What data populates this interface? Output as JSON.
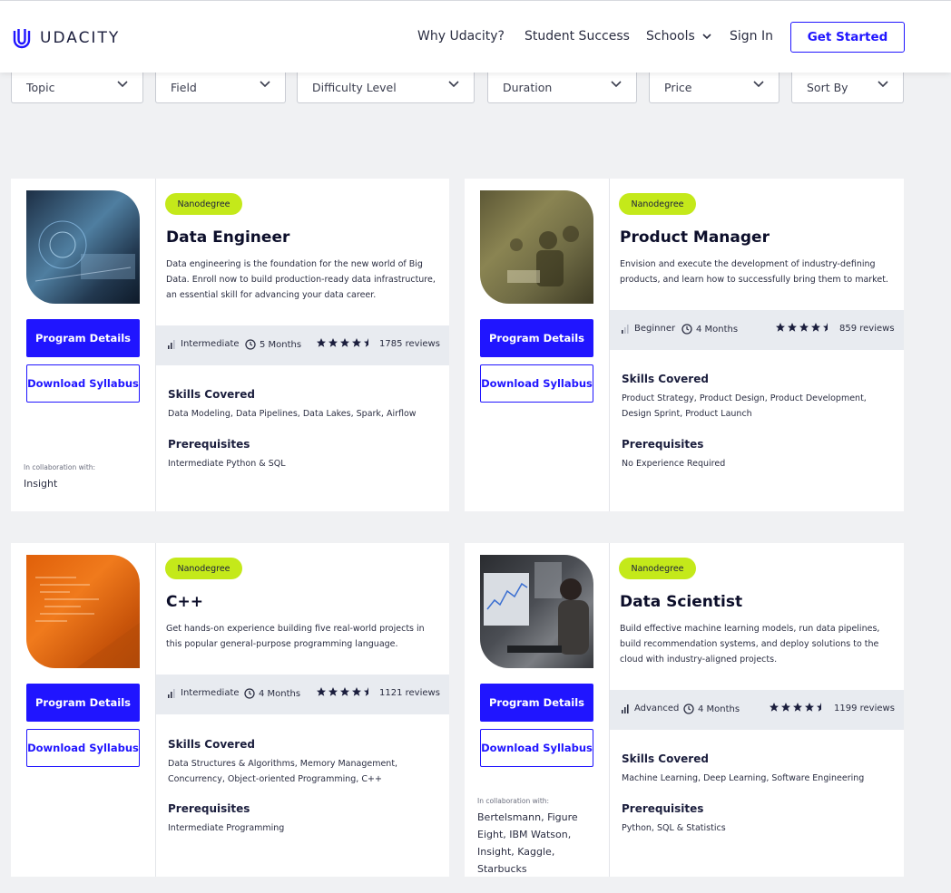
{
  "header": {
    "brand": "UDACITY",
    "nav": [
      "Why Udacity?",
      "Student Success",
      "Schools",
      "Sign In"
    ],
    "cta": "Get Started"
  },
  "filters": [
    "Topic",
    "Field",
    "Difficulty Level",
    "Duration",
    "Price",
    "Sort By"
  ],
  "colors": {
    "accent": "#2015ff",
    "badge": "#c4e91a",
    "meta_bg": "#e8ebf0"
  },
  "cards": [
    {
      "badge": "Nanodegree",
      "title": "Data Engineer",
      "description": "Data engineering is the foundation for the new world of Big Data. Enroll now to build production-ready data infrastructure, an essential skill for advancing your data career.",
      "level": "Intermediate",
      "duration": "5 Months",
      "rating_stars": 4.5,
      "reviews": "1785 reviews",
      "skills_heading": "Skills Covered",
      "skills": "Data Modeling, Data Pipelines, Data Lakes, Spark, Airflow",
      "prereq_heading": "Prerequisites",
      "prereq": "Intermediate Python & SQL",
      "program_details": "Program Details",
      "download_syllabus": "Download Syllabus",
      "collab_label": "In collaboration with:",
      "collab": "Insight"
    },
    {
      "badge": "Nanodegree",
      "title": "Product Manager",
      "description": "Envision and execute the development of industry-defining products, and learn how to successfully bring them to market.",
      "level": "Beginner",
      "duration": "4 Months",
      "rating_stars": 4.5,
      "reviews": "859 reviews",
      "skills_heading": "Skills Covered",
      "skills": "Product Strategy, Product Design, Product Development, Design Sprint, Product Launch",
      "prereq_heading": "Prerequisites",
      "prereq": "No Experience Required",
      "program_details": "Program Details",
      "download_syllabus": "Download Syllabus"
    },
    {
      "badge": "Nanodegree",
      "title": "C++",
      "description": "Get hands-on experience building five real-world projects in this popular general-purpose programming language.",
      "level": "Intermediate",
      "duration": "4 Months",
      "rating_stars": 4.5,
      "reviews": "1121 reviews",
      "skills_heading": "Skills Covered",
      "skills": "Data Structures & Algorithms, Memory Management, Concurrency, Object-oriented Programming, C++",
      "prereq_heading": "Prerequisites",
      "prereq": "Intermediate Programming",
      "program_details": "Program Details",
      "download_syllabus": "Download Syllabus"
    },
    {
      "badge": "Nanodegree",
      "title": "Data Scientist",
      "description": "Build effective machine learning models, run data pipelines, build recommendation systems, and deploy solutions to the cloud with industry-aligned projects.",
      "level": "Advanced",
      "duration": "4 Months",
      "rating_stars": 4.5,
      "reviews": "1199 reviews",
      "skills_heading": "Skills Covered",
      "skills": "Machine Learning, Deep Learning, Software Engineering",
      "prereq_heading": "Prerequisites",
      "prereq": "Python, SQL & Statistics",
      "program_details": "Program Details",
      "download_syllabus": "Download Syllabus",
      "collab_label": "In collaboration with:",
      "collab": "Bertelsmann, Figure Eight, IBM Watson, Insight, Kaggle, Starbucks"
    }
  ]
}
